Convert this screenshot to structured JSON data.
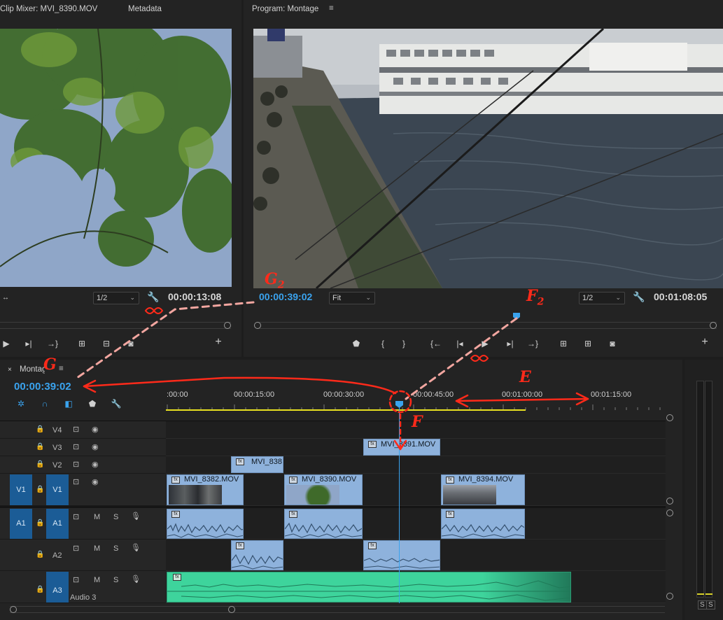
{
  "source_monitor": {
    "tab_clip": "Clip Mixer: MVI_8390.MOV",
    "tab_meta": "Metadata",
    "resolution": "1/2",
    "timecode": "00:00:13:08"
  },
  "program_monitor": {
    "tab": "Program: Montage",
    "timecode_current": "00:00:39:02",
    "fit": "Fit",
    "resolution": "1/2",
    "timecode_duration": "00:01:08:05"
  },
  "timeline": {
    "tab": "Montage",
    "timecode": "00:00:39:02",
    "ruler": [
      ":00:00",
      "00:00:15:00",
      "00:00:30:00",
      "00:00:45:00",
      "00:01:00:00",
      "00:01:15:00"
    ],
    "tracks": {
      "v4": "V4",
      "v3": "V3",
      "v2": "V2",
      "v1_src": "V1",
      "v1": "V1",
      "a1_src": "A1",
      "a1": "A1",
      "a2": "A2",
      "a3": "A3",
      "a3_name": "Audio 3",
      "mute": "M",
      "solo": "S"
    },
    "clips": {
      "v3_clip": "MVI_8391.MOV",
      "v2_clip": "MVI_838",
      "v1_clip1": "MVI_8382.MOV",
      "v1_clip2": "MVI_8390.MOV",
      "v1_clip3": "MVI_8394.MOV"
    }
  },
  "meter": {
    "s1": "S",
    "s2": "S"
  },
  "annotations": {
    "g2": "G",
    "g2_sub": "2",
    "f2": "F",
    "f2_sub": "2",
    "g": "G",
    "e": "E",
    "f": "F"
  },
  "colors": {
    "accent_blue": "#3aa3ee",
    "annotation_red": "#ff2a1a",
    "clip_blue": "#8eb2dc",
    "clip_green": "#3ed49c",
    "work_area_yellow": "#e8e020"
  }
}
